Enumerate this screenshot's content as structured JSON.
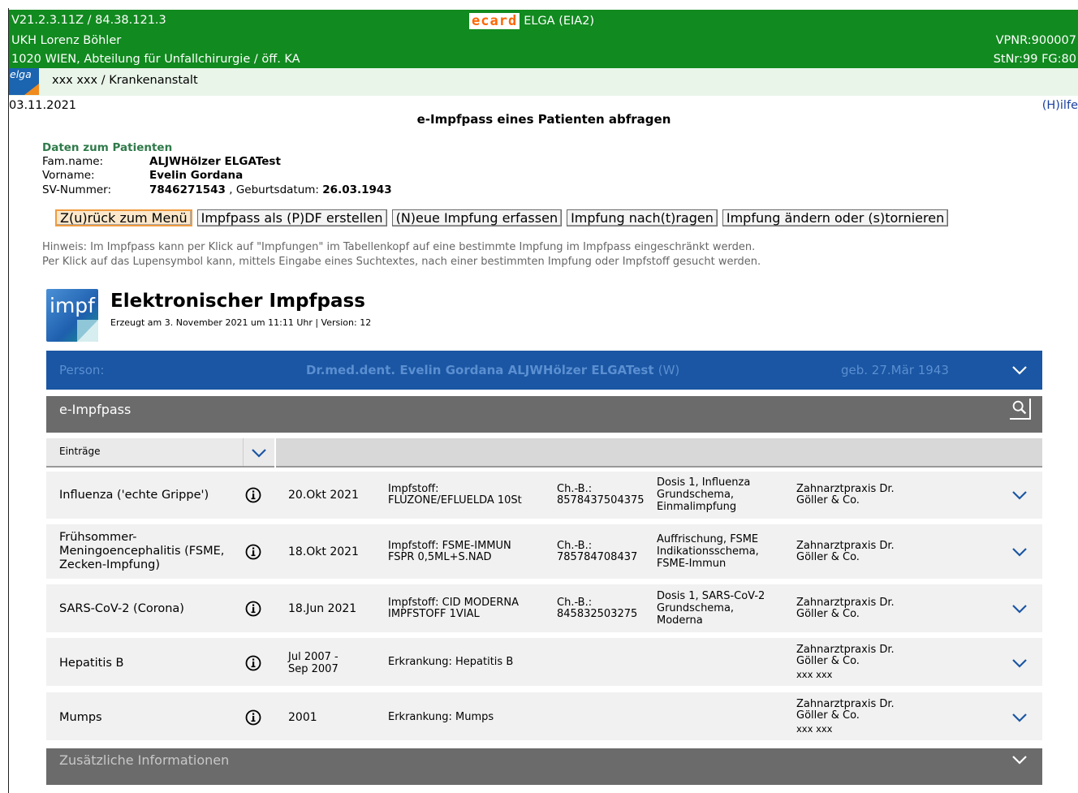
{
  "header": {
    "version": "V21.2.3.11Z / 84.38.121.3",
    "hospital": "UKH Lorenz Böhler",
    "department": "1020 WIEN, Abteilung für Unfallchirurgie / öff. KA",
    "ecard_logo": "ecard",
    "system": "ELGA (EIA2)",
    "vpnr": "VPNR:900007",
    "stnr": "StNr:99 FG:80"
  },
  "subbar": {
    "elga_logo": "elga",
    "user": "xxx xxx / Krankenanstalt"
  },
  "date": "03.11.2021",
  "help": "(H)ilfe",
  "page_title": "e-Impfpass eines Patienten abfragen",
  "patient": {
    "heading": "Daten zum Patienten",
    "famname_label": "Fam.name:",
    "famname": "ALJWHölzer ELGATest",
    "vorname_label": "Vorname:",
    "vorname": "Evelin Gordana",
    "sv_label": "SV-Nummer:",
    "sv": "7846271543",
    "geb_label": ", Geburtsdatum:",
    "geb": "26.03.1943"
  },
  "buttons": {
    "back": "Z(u)rück zum Menü",
    "pdf": "Impfpass als (P)DF erstellen",
    "new": "(N)eue Impfung erfassen",
    "nachtragen": "Impfung nach(t)ragen",
    "aendern": "Impfung ändern oder (s)tornieren"
  },
  "hint": {
    "line1": "Hinweis: Im Impfpass kann per Klick auf \"Impfungen\" im Tabellenkopf auf eine bestimmte Impfung im Impfpass eingeschränkt werden.",
    "line2": "Per Klick auf das Lupensymbol kann, mittels Eingabe eines Suchtextes, nach einer bestimmten Impfung oder Impfstoff gesucht werden."
  },
  "impfpass": {
    "logo_text": "impf",
    "title": "Elektronischer Impfpass",
    "subtitle": "Erzeugt am 3. November 2021 um 11:11 Uhr | Version: 12"
  },
  "person": {
    "label": "Person:",
    "name": "Dr.med.dent. Evelin Gordana ALJWHölzer ELGATest",
    "sex": "(W)",
    "geb": "geb. 27.Mär 1943"
  },
  "section_title": "e-Impfpass",
  "filter_label": "Einträge",
  "entries": [
    {
      "name": "Influenza ('echte Grippe')",
      "date": "20.Okt 2021",
      "stoff1": "Impfstoff:",
      "stoff2": "FLUZONE/EFLUELDA 10St",
      "charge1": "Ch.-B.:",
      "charge2": "8578437504375",
      "dosis1": "Dosis 1, Influenza",
      "dosis2": "Grundschema,",
      "dosis3": "Einmalimpfung",
      "praxis1": "Zahnarztpraxis Dr.",
      "praxis2": "Göller & Co.",
      "praxis3": ""
    },
    {
      "name": "Frühsommer-Meningoencephalitis (FSME, Zecken-Impfung)",
      "date": "18.Okt 2021",
      "stoff1": "Impfstoff: FSME-IMMUN",
      "stoff2": "FSPR 0,5ML+S.NAD",
      "charge1": "Ch.-B.:",
      "charge2": "785784708437",
      "dosis1": "Auffrischung, FSME",
      "dosis2": "Indikationsschema,",
      "dosis3": "FSME-Immun",
      "praxis1": "Zahnarztpraxis Dr.",
      "praxis2": "Göller & Co.",
      "praxis3": ""
    },
    {
      "name": "SARS-CoV-2 (Corona)",
      "date": "18.Jun 2021",
      "stoff1": "Impfstoff: CID MODERNA",
      "stoff2": "IMPFSTOFF 1VIAL",
      "charge1": "Ch.-B.:",
      "charge2": "845832503275",
      "dosis1": "Dosis 1, SARS-CoV-2",
      "dosis2": "Grundschema,",
      "dosis3": "Moderna",
      "praxis1": "Zahnarztpraxis Dr.",
      "praxis2": "Göller & Co.",
      "praxis3": ""
    },
    {
      "name": "Hepatitis B",
      "date": "Jul 2007 -",
      "date2": "Sep 2007",
      "stoff1": "Erkrankung: Hepatitis B",
      "stoff2": "",
      "charge1": "",
      "charge2": "",
      "dosis1": "",
      "dosis2": "",
      "dosis3": "",
      "praxis1": "Zahnarztpraxis Dr.",
      "praxis2": "Göller & Co.",
      "praxis3": "xxx xxx"
    },
    {
      "name": "Mumps",
      "date": "2001",
      "stoff1": "Erkrankung: Mumps",
      "stoff2": "",
      "charge1": "",
      "charge2": "",
      "dosis1": "",
      "dosis2": "",
      "dosis3": "",
      "praxis1": "Zahnarztpraxis Dr.",
      "praxis2": "Göller & Co.",
      "praxis3": "xxx xxx"
    }
  ],
  "footer_section": "Zusätzliche Informationen",
  "colors": {
    "header_green": "#118a1f",
    "subbar_green": "#e9f5e9",
    "person_blue": "#1a56a3",
    "section_gray": "#6b6b6b",
    "row_bg": "#f1f1f1",
    "accent_blue": "#1a56a3",
    "active_button_border": "#f09b3e"
  },
  "icons": {
    "info": "info-icon",
    "chevron": "chevron-down-icon",
    "search": "search-icon"
  }
}
